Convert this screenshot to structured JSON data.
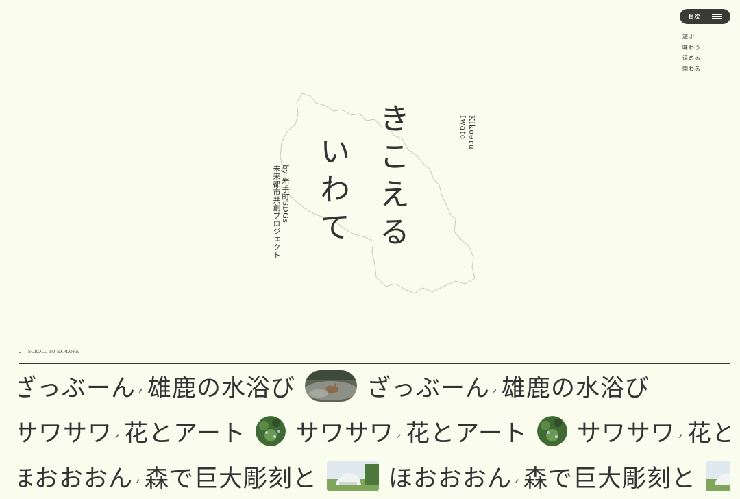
{
  "menu": {
    "label": "目次"
  },
  "nav": {
    "items": [
      "遊ぶ",
      "味わう",
      "深める",
      "関わる"
    ]
  },
  "hero": {
    "title_col1": "きこえる",
    "title_col2": "いわて",
    "subtitle_en": "Kikoeru\nIwate",
    "byline": "by 岩手町SDGs\n未来都市共創プロジェクト"
  },
  "scroll_hint": "SCROLL TO EXPLORE",
  "marquee": {
    "row1": {
      "a": "ざっぶーん",
      "b": "雄鹿の水浴び",
      "a2": "ざっぶーん",
      "b2": "雄鹿の水浴び"
    },
    "row2": {
      "a": "サワサワ",
      "b": "花とアート",
      "a2": "サワサワ",
      "b2": "花とアート",
      "a3": "サワサワ",
      "b3": "花とアート"
    },
    "row3": {
      "a": "ほおおおん",
      "b": "森で巨大彫刻と",
      "a2": "ほおおおん",
      "b2": "森で巨大彫刻と"
    }
  },
  "colors": {
    "background": "#fafcee",
    "text": "#333333",
    "pill": "#3a3a37"
  }
}
